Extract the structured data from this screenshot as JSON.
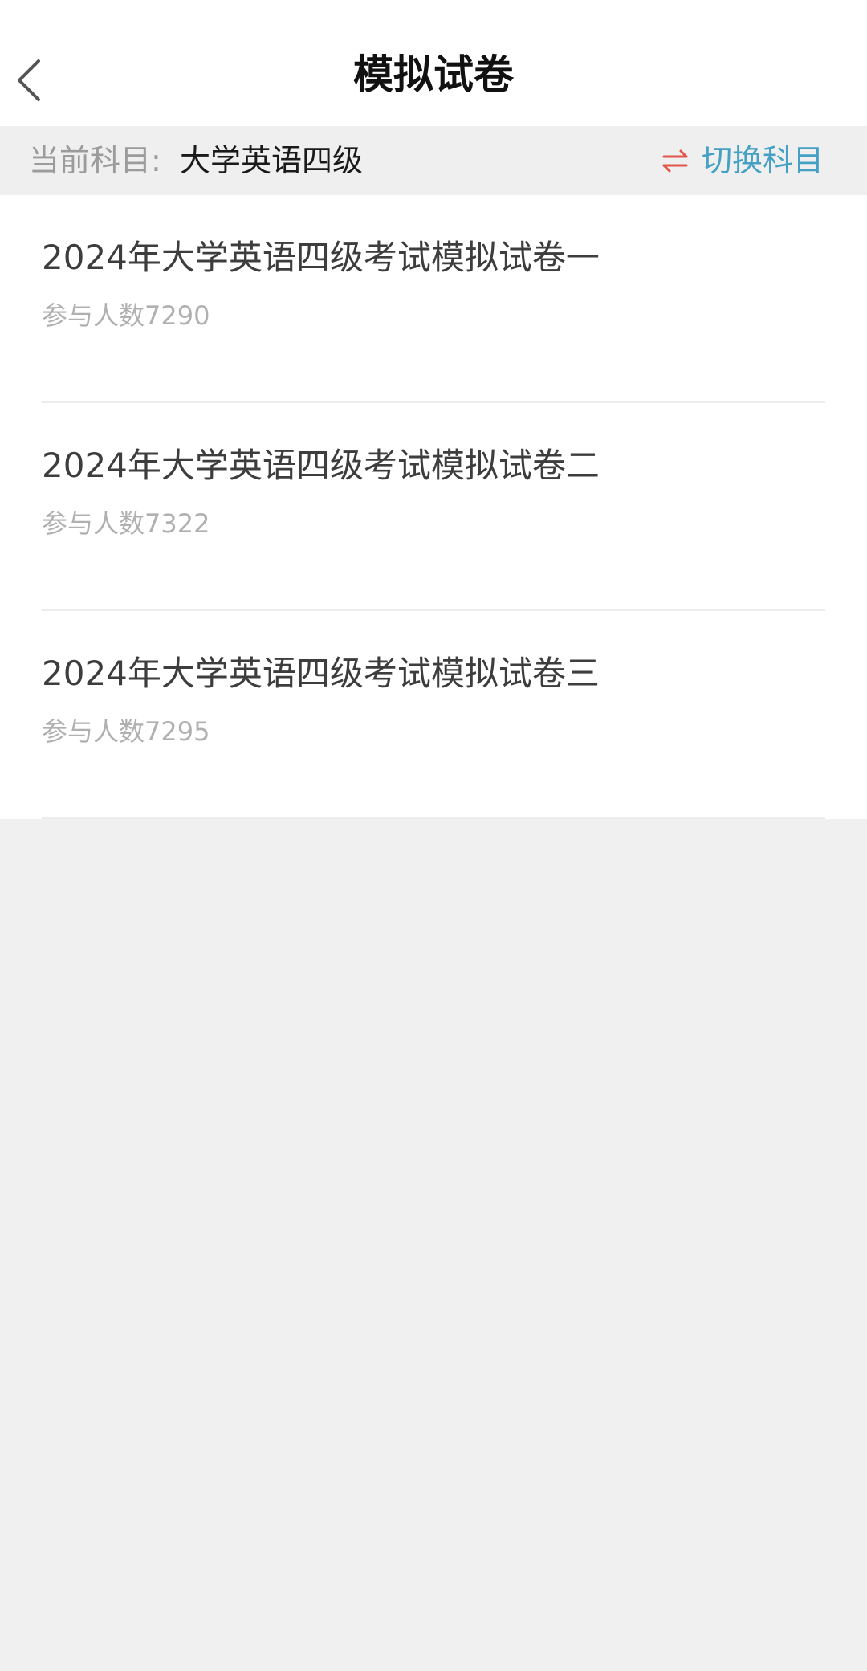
{
  "header": {
    "title": "模拟试卷",
    "back_icon": "chevron-left-icon"
  },
  "subject_bar": {
    "label": "当前科目:",
    "current": "大学英语四级",
    "switch_label": "切换科目",
    "switch_icon": "swap-arrows-icon",
    "switch_icon_color": "#e2574c",
    "switch_label_color": "#44a1c4"
  },
  "papers": [
    {
      "title": "2024年大学英语四级考试模拟试卷一",
      "participants": "参与人数7290"
    },
    {
      "title": "2024年大学英语四级考试模拟试卷二",
      "participants": "参与人数7322"
    },
    {
      "title": "2024年大学英语四级考试模拟试卷三",
      "participants": "参与人数7295"
    }
  ]
}
